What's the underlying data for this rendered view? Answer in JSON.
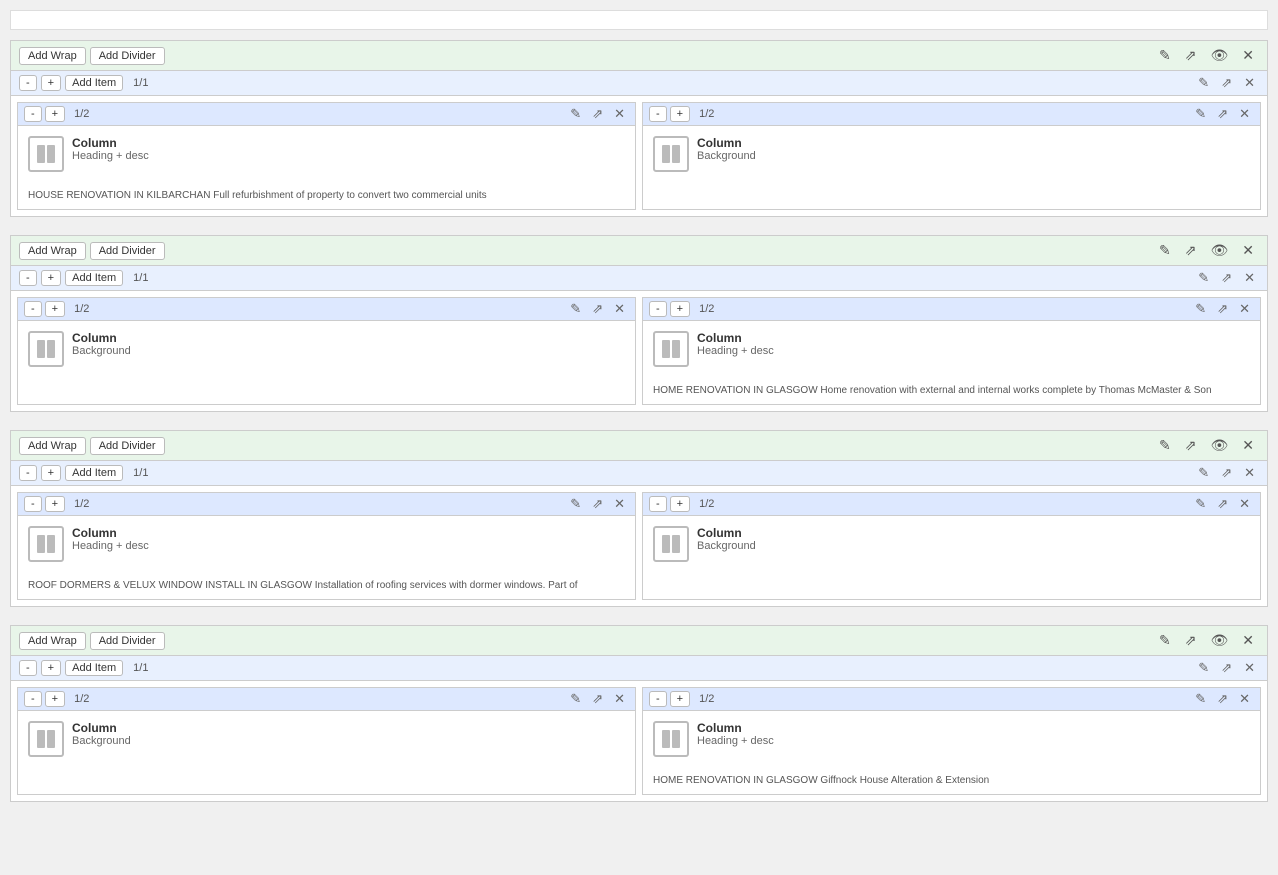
{
  "topBar": {},
  "sections": [
    {
      "id": "section-1",
      "toolbar": {
        "addWrap": "Add Wrap",
        "addDivider": "Add Divider"
      },
      "row": {
        "minus": "-",
        "plus": "+",
        "addItem": "Add Item",
        "ratio": "1/1"
      },
      "columns": [
        {
          "ratio": "1/2",
          "type": "heading-desc",
          "title": "Column",
          "subtitle": "Heading + desc",
          "text": "HOUSE RENOVATION IN KILBARCHAN Full refurbishment of property to convert two commercial units"
        },
        {
          "ratio": "1/2",
          "type": "background",
          "title": "Column",
          "subtitle": "Background",
          "text": ""
        }
      ]
    },
    {
      "id": "section-2",
      "toolbar": {
        "addWrap": "Add Wrap",
        "addDivider": "Add Divider"
      },
      "row": {
        "minus": "-",
        "plus": "+",
        "addItem": "Add Item",
        "ratio": "1/1"
      },
      "columns": [
        {
          "ratio": "1/2",
          "type": "background",
          "title": "Column",
          "subtitle": "Background",
          "text": ""
        },
        {
          "ratio": "1/2",
          "type": "heading-desc",
          "title": "Column",
          "subtitle": "Heading + desc",
          "text": "HOME RENOVATION IN GLASGOW Home renovation with external and internal works complete by Thomas McMaster & Son"
        }
      ]
    },
    {
      "id": "section-3",
      "toolbar": {
        "addWrap": "Add Wrap",
        "addDivider": "Add Divider"
      },
      "row": {
        "minus": "-",
        "plus": "+",
        "addItem": "Add Item",
        "ratio": "1/1"
      },
      "columns": [
        {
          "ratio": "1/2",
          "type": "heading-desc",
          "title": "Column",
          "subtitle": "Heading + desc",
          "text": "ROOF DORMERS & VELUX WINDOW INSTALL IN GLASGOW Installation of roofing services with dormer windows. Part of"
        },
        {
          "ratio": "1/2",
          "type": "background",
          "title": "Column",
          "subtitle": "Background",
          "text": ""
        }
      ]
    },
    {
      "id": "section-4",
      "toolbar": {
        "addWrap": "Add Wrap",
        "addDivider": "Add Divider"
      },
      "row": {
        "minus": "-",
        "plus": "+",
        "addItem": "Add Item",
        "ratio": "1/1"
      },
      "columns": [
        {
          "ratio": "1/2",
          "type": "background",
          "title": "Column",
          "subtitle": "Background",
          "text": ""
        },
        {
          "ratio": "1/2",
          "type": "heading-desc",
          "title": "Column",
          "subtitle": "Heading + desc",
          "text": "HOME RENOVATION IN GLASGOW Giffnock House Alteration & Extension"
        }
      ]
    }
  ],
  "icons": {
    "edit": "✏️",
    "share": "↗",
    "eye": "👁",
    "close": "✕",
    "pencil": "✎"
  }
}
